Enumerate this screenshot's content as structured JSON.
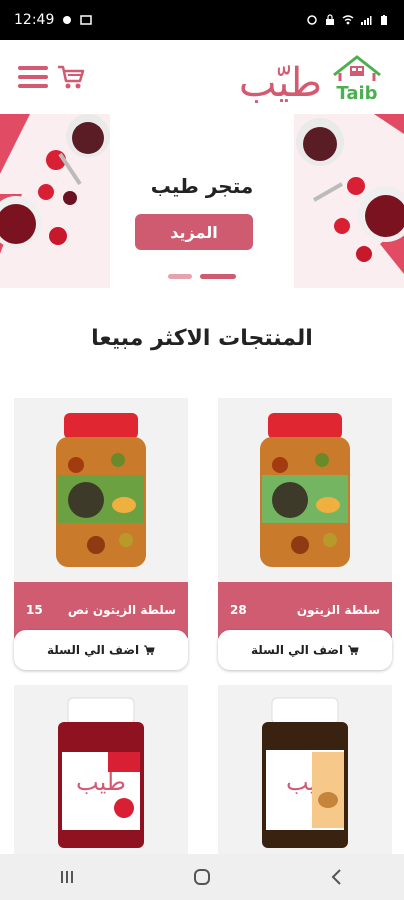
{
  "status": {
    "time": "12:49"
  },
  "brand": {
    "logo_ar": "طيّب",
    "logo_en": "Taib"
  },
  "hero": {
    "title": "متجر طيب",
    "button": "المزيد"
  },
  "section": {
    "title": "المنتجات الاكثر مبيعا"
  },
  "products": [
    {
      "name": "سلطة الزيتون",
      "price": "28",
      "add_label": "اضف الي السلة"
    },
    {
      "name": "سلطة الزيتون نص",
      "price": "15",
      "add_label": "اضف الي السلة"
    },
    {
      "name": "",
      "price": "",
      "add_label": ""
    },
    {
      "name": "",
      "price": "",
      "add_label": ""
    }
  ],
  "colors": {
    "accent": "#cf5b70",
    "logo_green": "#4caf50"
  },
  "icons": [
    "menu-icon",
    "cart-icon",
    "back-icon",
    "home-icon",
    "recents-icon"
  ]
}
